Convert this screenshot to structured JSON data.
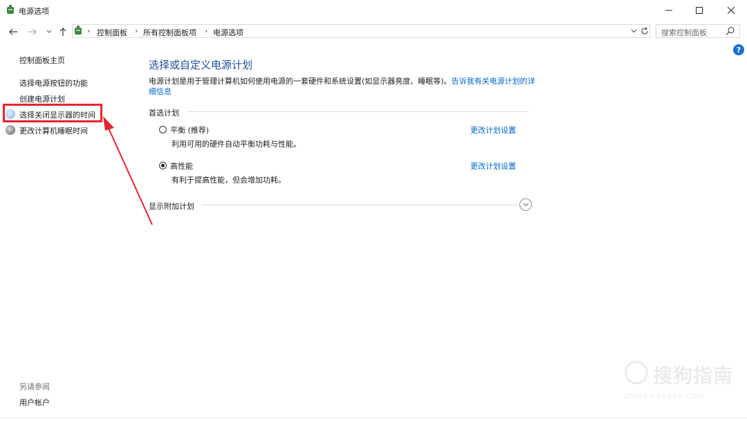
{
  "window": {
    "title": "电源选项",
    "minimize_icon": "minimize-icon",
    "maximize_icon": "maximize-icon",
    "close_icon": "close-icon"
  },
  "address": {
    "crumbs": [
      "控制面板",
      "所有控制面板项",
      "电源选项"
    ],
    "search_placeholder": "搜索控制面板"
  },
  "sidebar": {
    "home": "控制面板主页",
    "links": [
      "选择电源按钮的功能",
      "创建电源计划",
      "选择关闭显示器的时间",
      "更改计算机睡眠时间"
    ],
    "see_also_header": "另请参阅",
    "see_also_link": "用户帐户"
  },
  "main": {
    "title": "选择或自定义电源计划",
    "desc_text": "电源计划是用于管理计算机如何使用电源的一套硬件和系统设置(如显示器亮度、睡眠等)。",
    "desc_link": "告诉我有关电源计划的详细信息",
    "preferred_label": "首选计划",
    "plans": [
      {
        "name": "平衡 (推荐)",
        "desc": "利用可用的硬件自动平衡功耗与性能。",
        "link": "更改计划设置",
        "selected": false
      },
      {
        "name": "高性能",
        "desc": "有利于提高性能，但会增加功耗。",
        "link": "更改计划设置",
        "selected": true
      }
    ],
    "additional_label": "显示附加计划"
  },
  "annotation_color": "#e8242c",
  "watermark": {
    "main": "搜狗指南",
    "sub": "zhinan.sogou.com"
  }
}
